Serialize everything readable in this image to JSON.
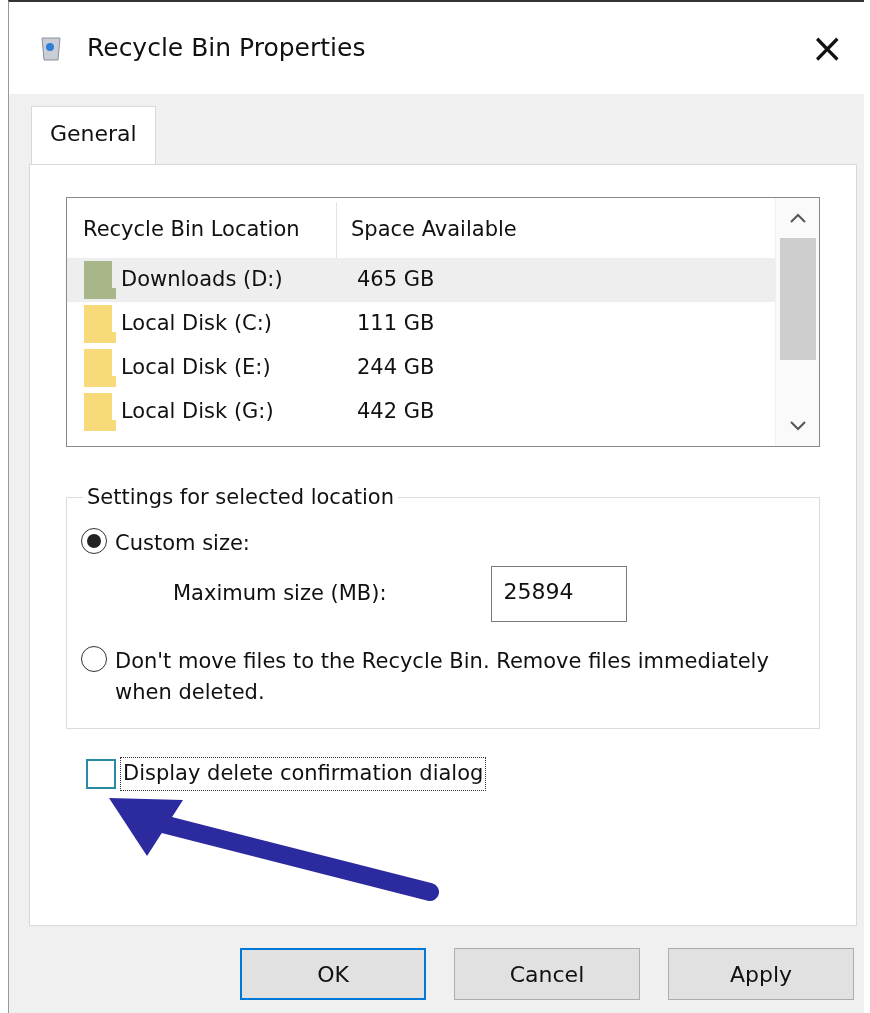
{
  "window": {
    "title": "Recycle Bin Properties",
    "close": "×"
  },
  "tabs": [
    {
      "label": "General",
      "selected": true
    }
  ],
  "locations": {
    "columns": [
      "Recycle Bin Location",
      "Space Available"
    ],
    "rows": [
      {
        "name": "Downloads  (D:)",
        "space": "465 GB",
        "selected": true,
        "color": "#a9b68a"
      },
      {
        "name": "Local Disk (C:)",
        "space": "111 GB",
        "selected": false,
        "color": "#f7da7a"
      },
      {
        "name": "Local Disk (E:)",
        "space": "244 GB",
        "selected": false,
        "color": "#f7da7a"
      },
      {
        "name": "Local Disk (G:)",
        "space": "442 GB",
        "selected": false,
        "color": "#f7da7a"
      }
    ]
  },
  "settings": {
    "title": "Settings for selected location",
    "options": [
      {
        "label": "Custom size:",
        "selected": true
      },
      {
        "label": "Don't move files to the Recycle Bin. Remove files immediately when deleted.",
        "selected": false
      }
    ],
    "max_label": "Maximum size (MB):",
    "max_value": "25894"
  },
  "confirm": {
    "label": "Display delete confirmation dialog",
    "checked": false
  },
  "buttons": [
    {
      "label": "OK",
      "default": true
    },
    {
      "label": "Cancel",
      "default": false
    },
    {
      "label": "Apply",
      "default": false
    }
  ]
}
